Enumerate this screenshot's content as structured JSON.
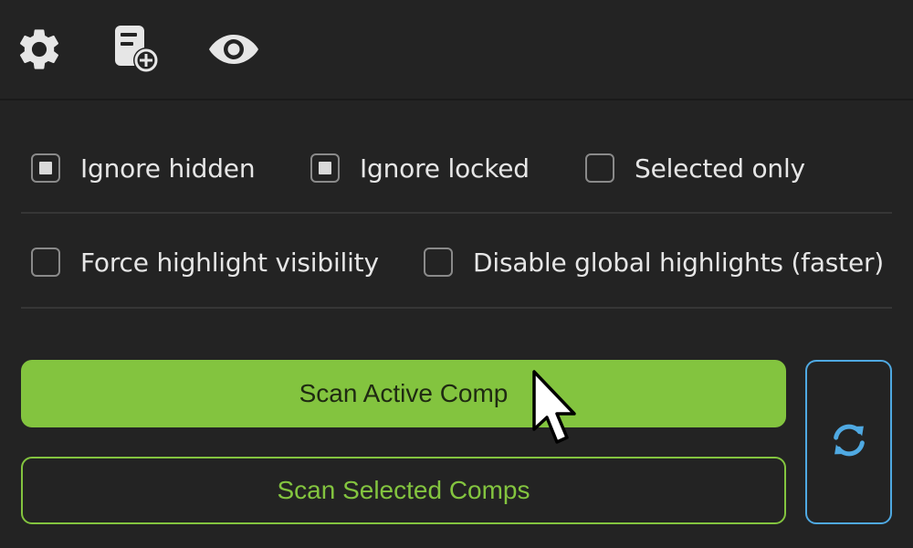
{
  "toolbar": {
    "icons": [
      "gear-icon",
      "add-document-icon",
      "eye-icon"
    ]
  },
  "options": {
    "ignore_hidden": {
      "label": "Ignore hidden",
      "checked": true
    },
    "ignore_locked": {
      "label": "Ignore locked",
      "checked": true
    },
    "selected_only": {
      "label": "Selected only",
      "checked": false
    },
    "force_highlight": {
      "label": "Force highlight visibility",
      "checked": false
    },
    "disable_global": {
      "label": "Disable global highlights (faster)",
      "checked": false
    }
  },
  "actions": {
    "scan_active": "Scan Active Comp",
    "scan_selected": "Scan Selected Comps",
    "refresh_icon": "refresh-icon"
  },
  "colors": {
    "background": "#232323",
    "accent_green": "#83c43f",
    "accent_blue": "#4fa9e2",
    "text": "#e6e6e6"
  }
}
